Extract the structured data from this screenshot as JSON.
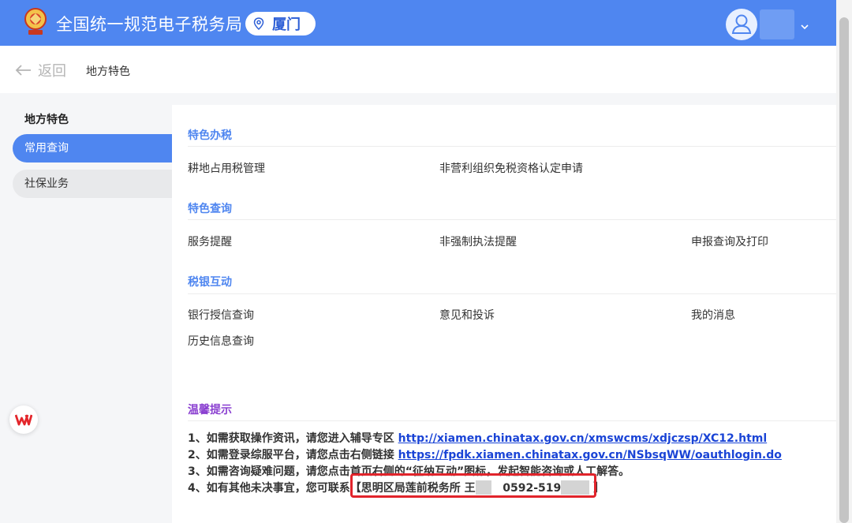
{
  "header": {
    "site_title": "全国统一规范电子税务局",
    "city": "厦门",
    "icons": {
      "logo": "tax-emblem-icon",
      "location": "location-pin-icon",
      "avatar": "user-avatar-icon",
      "chevron": "chevron-down-icon"
    },
    "colors": {
      "bar": "#4f86f0",
      "city_text": "#2d5fd6"
    }
  },
  "breadcrumb": {
    "back_label": "返回",
    "current": "地方特色"
  },
  "sidebar": {
    "heading": "地方特色",
    "items": [
      {
        "label": "常用查询",
        "active": true
      },
      {
        "label": "社保业务",
        "active": false
      }
    ]
  },
  "sections": [
    {
      "title": "特色办税",
      "items": [
        "耕地占用税管理",
        "非营利组织免税资格认定申请"
      ]
    },
    {
      "title": "特色查询",
      "items": [
        "服务提醒",
        "非强制执法提醒",
        "申报查询及打印"
      ]
    },
    {
      "title": "税银互动",
      "items": [
        "银行授信查询",
        "意见和投诉",
        "我的消息",
        "历史信息查询"
      ]
    }
  ],
  "tips": {
    "title": "温馨提示",
    "line1": {
      "text": "1、如需获取操作资讯，请您进入辅导专区 ",
      "link": "http://xiamen.chinatax.gov.cn/xmswcms/xdjczsp/XC12.html"
    },
    "line2": {
      "text": "2、如需登录综服平台，请您点击右侧链接 ",
      "link": "https://fpdk.xiamen.chinatax.gov.cn/NSbsqWW/oauthlogin.do"
    },
    "line3": {
      "text": "3、如需咨询疑难问题，请您点击首页右侧的“征纳互动”图标，发起智能咨询或人工解答。"
    },
    "line4": {
      "text": "4、如有其他未决事宜，您可联系",
      "contact_prefix": "【思明区局莲前税务所 王",
      "phone_prefix": "0592-519",
      "contact_suffix": "】"
    },
    "colors": {
      "title": "#8a3fd0",
      "link": "#1a44d6",
      "highlight_border": "#e1242b"
    }
  }
}
